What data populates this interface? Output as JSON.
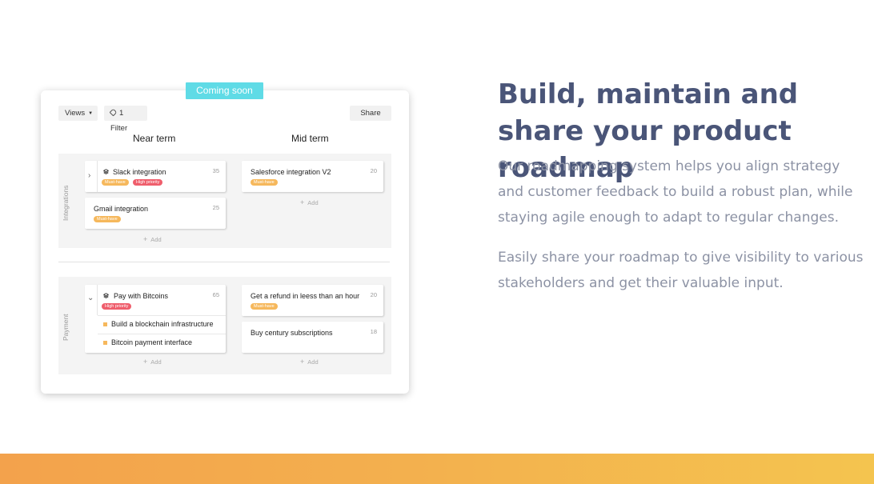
{
  "badge_coming_soon": "Coming soon",
  "toolbar": {
    "views_label": "Views",
    "filter_label": "1 Filter",
    "share_label": "Share"
  },
  "columns": [
    "Near term",
    "Mid term"
  ],
  "lanes": [
    {
      "label": "Integrations",
      "near_term": [
        {
          "title": "Slack integration",
          "number": "35",
          "badges": [
            "Must-have",
            "High priority"
          ]
        },
        {
          "title": "Gmail integration",
          "number": "25",
          "badges": [
            "Must-have"
          ]
        }
      ],
      "mid_term": [
        {
          "title": "Salesforce integration V2",
          "number": "20",
          "badges": [
            "Must-have"
          ]
        }
      ]
    },
    {
      "label": "Payment",
      "near_term": [
        {
          "title": "Pay with Bitcoins",
          "number": "65",
          "badges": [
            "High priority"
          ],
          "subitems": [
            "Build a blockchain infrastructure",
            "Bitcoin payment interface"
          ]
        }
      ],
      "mid_term": [
        {
          "title": "Get a refund in leess than an hour",
          "number": "20",
          "badges": [
            "Must-have"
          ]
        },
        {
          "title": "Buy century subscriptions",
          "number": "18",
          "badges": []
        }
      ]
    }
  ],
  "add_label": "Add",
  "heading": "Build, maintain and share your product roadmap",
  "paragraph_1": "Our roadmapping system helps you align strategy and customer feedback to build a robust plan, while staying agile enough to adapt to regular changes.",
  "paragraph_2": "Easily share your roadmap to give visibility to various stakeholders and get their valuable input.",
  "colors": {
    "heading": "#4a5578",
    "body_text": "#8c92a4",
    "coming_soon": "#5fdbe6",
    "must_have": "#f6b85c",
    "high_priority": "#ef5e6c",
    "bar_start": "#f3a24c",
    "bar_end": "#f4c44f"
  }
}
